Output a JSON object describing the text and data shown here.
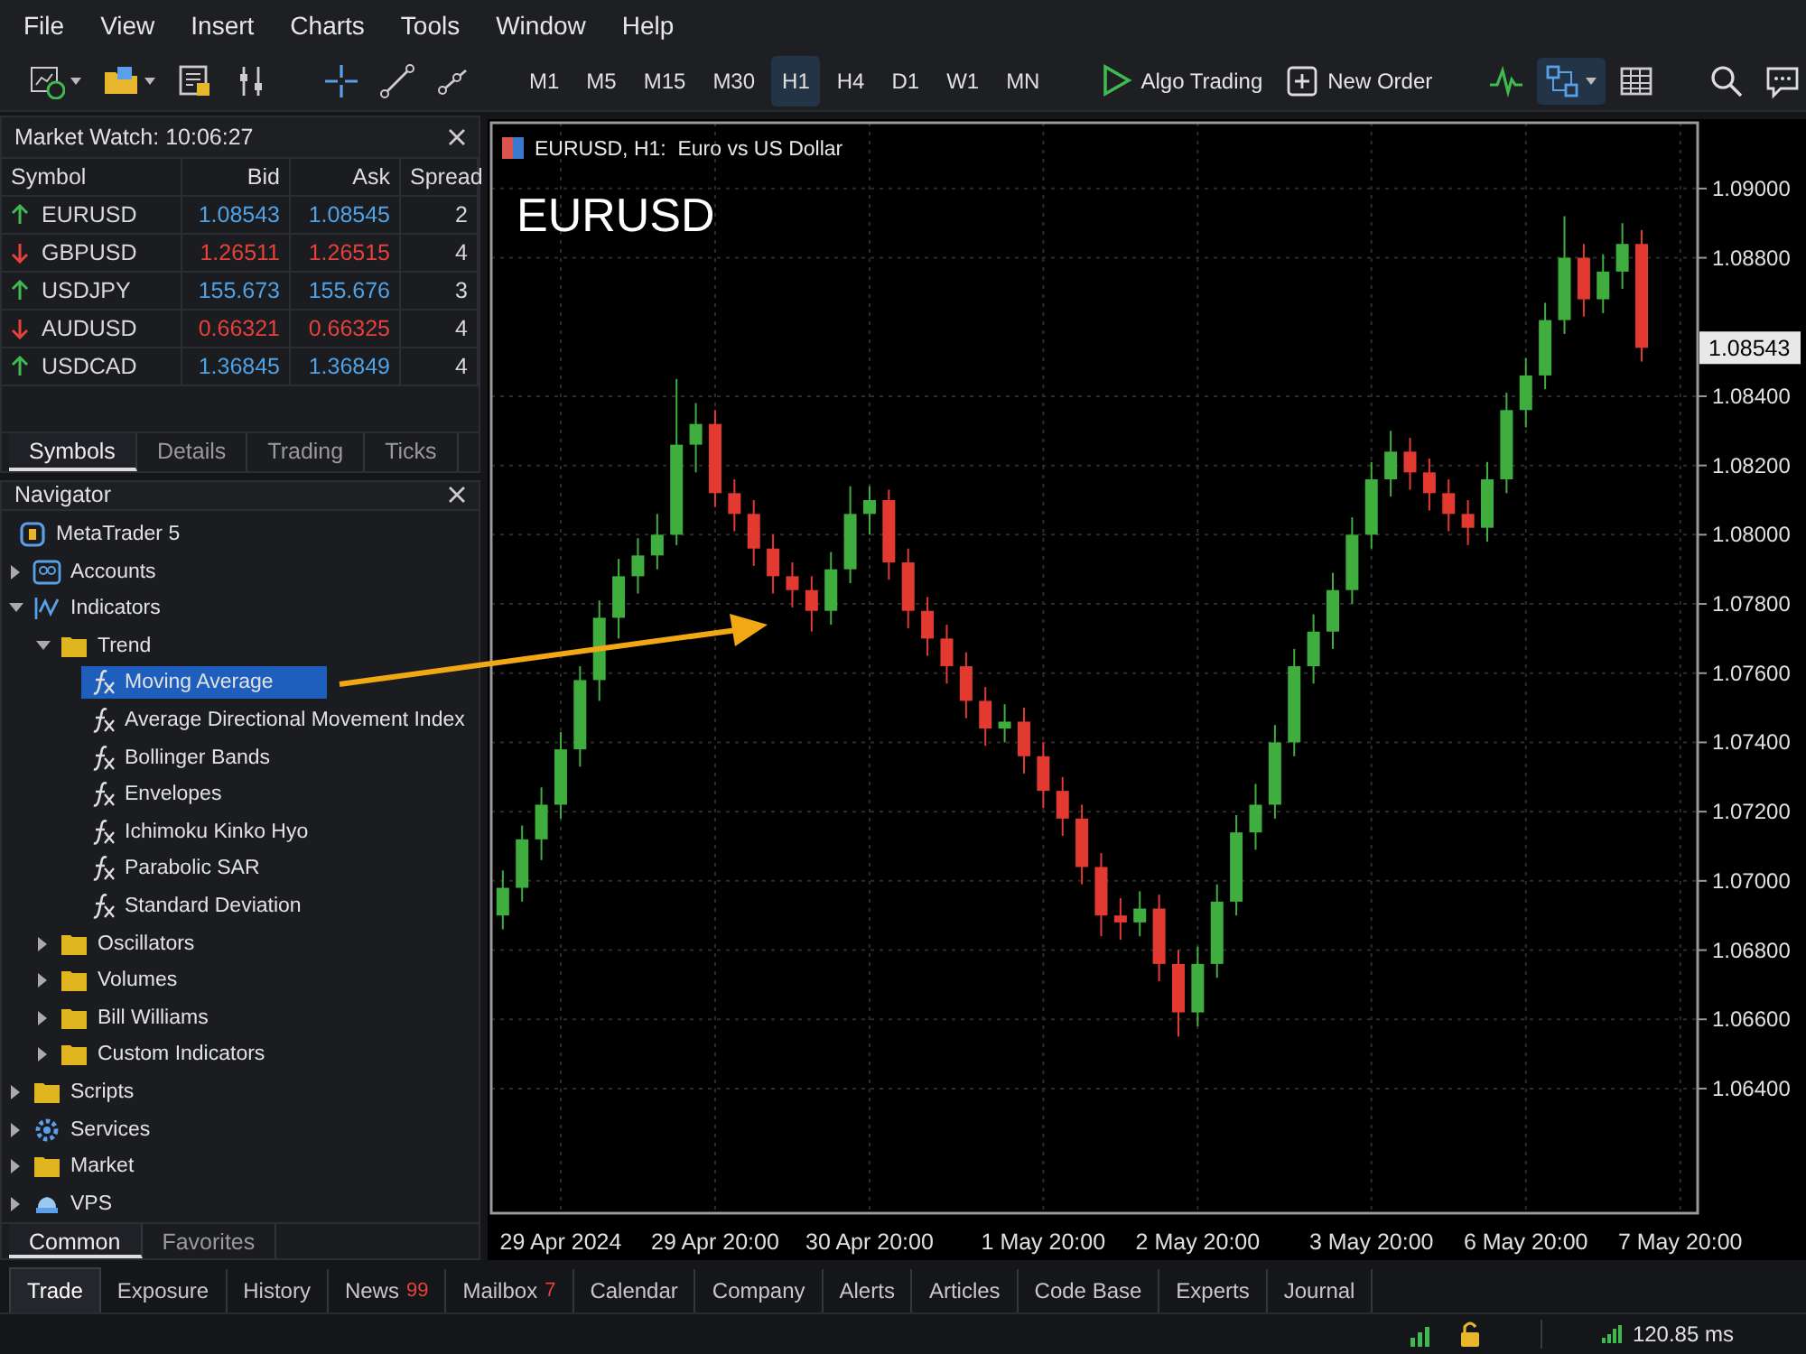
{
  "menu": [
    {
      "label": "File"
    },
    {
      "label": "View"
    },
    {
      "label": "Insert"
    },
    {
      "label": "Charts"
    },
    {
      "label": "Tools"
    },
    {
      "label": "Window"
    },
    {
      "label": "Help"
    }
  ],
  "toolbar": {
    "timeframes": [
      {
        "label": "M1",
        "selected": false
      },
      {
        "label": "M5",
        "selected": false
      },
      {
        "label": "M15",
        "selected": false
      },
      {
        "label": "M30",
        "selected": false
      },
      {
        "label": "H1",
        "selected": true
      },
      {
        "label": "H4",
        "selected": false
      },
      {
        "label": "D1",
        "selected": false
      },
      {
        "label": "W1",
        "selected": false
      },
      {
        "label": "MN",
        "selected": false
      }
    ],
    "actions": [
      {
        "label": "Algo Trading",
        "kind": "play"
      },
      {
        "label": "New Order",
        "kind": "add"
      }
    ]
  },
  "market_watch": {
    "title": "Market Watch: 10:06:27",
    "columns": [
      "Symbol",
      "Bid",
      "Ask",
      "Spread"
    ],
    "rows": [
      {
        "symbol": "EURUSD",
        "rising": true,
        "bid": "1.08543",
        "ask": "1.08545",
        "spread": "2"
      },
      {
        "symbol": "GBPUSD",
        "rising": false,
        "bid": "1.26511",
        "ask": "1.26515",
        "spread": "4"
      },
      {
        "symbol": "USDJPY",
        "rising": true,
        "bid": "155.673",
        "ask": "155.676",
        "spread": "3"
      },
      {
        "symbol": "AUDUSD",
        "rising": false,
        "bid": "0.66321",
        "ask": "0.66325",
        "spread": "4"
      },
      {
        "symbol": "USDCAD",
        "rising": true,
        "bid": "1.36845",
        "ask": "1.36849",
        "spread": "4"
      }
    ],
    "tabs": [
      {
        "label": "Symbols",
        "selected": true
      },
      {
        "label": "Details",
        "selected": false
      },
      {
        "label": "Trading",
        "selected": false
      },
      {
        "label": "Ticks",
        "selected": false
      }
    ]
  },
  "navigator": {
    "title": "Navigator",
    "tree": [
      {
        "label": "MetaTrader 5",
        "kind": "terminal",
        "selected": false,
        "children": [
          {
            "label": "Accounts",
            "kind": "accounts",
            "expanded": false,
            "selected": false
          },
          {
            "label": "Indicators",
            "kind": "indicators",
            "expanded": true,
            "selected": false,
            "children": [
              {
                "label": "Trend",
                "kind": "folder",
                "expanded": true,
                "selected": false,
                "children": [
                  {
                    "label": "Moving Average",
                    "kind": "function",
                    "selected": true
                  },
                  {
                    "label": "Average Directional Movement Index",
                    "kind": "function",
                    "selected": false
                  },
                  {
                    "label": "Bollinger Bands",
                    "kind": "function",
                    "selected": false
                  },
                  {
                    "label": "Envelopes",
                    "kind": "function",
                    "selected": false
                  },
                  {
                    "label": "Ichimoku Kinko Hyo",
                    "kind": "function",
                    "selected": false
                  },
                  {
                    "label": "Parabolic SAR",
                    "kind": "function",
                    "selected": false
                  },
                  {
                    "label": "Standard Deviation",
                    "kind": "function",
                    "selected": false
                  }
                ]
              },
              {
                "label": "Oscillators",
                "kind": "folder",
                "expanded": false,
                "selected": false
              },
              {
                "label": "Volumes",
                "kind": "folder",
                "expanded": false,
                "selected": false
              },
              {
                "label": "Bill Williams",
                "kind": "folder",
                "expanded": false,
                "selected": false
              },
              {
                "label": "Custom Indicators",
                "kind": "folder",
                "expanded": false,
                "selected": false
              }
            ]
          },
          {
            "label": "Scripts",
            "kind": "folder",
            "expanded": false,
            "selected": false
          },
          {
            "label": "Services",
            "kind": "services",
            "expanded": false,
            "selected": false
          },
          {
            "label": "Market",
            "kind": "folder",
            "expanded": false,
            "selected": false
          },
          {
            "label": "VPS",
            "kind": "vps",
            "expanded": false,
            "selected": false
          }
        ]
      }
    ],
    "tabs": [
      {
        "label": "Common",
        "selected": true
      },
      {
        "label": "Favorites",
        "selected": false
      }
    ]
  },
  "chart": {
    "title": "EURUSD, H1:  Euro vs US Dollar",
    "symbol": "EURUSD",
    "price_label": "1.08543",
    "chart_data": {
      "type": "candlestick",
      "grid": true,
      "ylim": [
        1.0604,
        1.0919
      ],
      "categories": [
        null,
        null,
        null,
        "29 Apr 2024",
        null,
        null,
        null,
        null,
        null,
        null,
        null,
        "29 Apr 20:00",
        null,
        null,
        null,
        null,
        null,
        null,
        null,
        "30 Apr 20:00",
        null,
        null,
        null,
        null,
        null,
        null,
        null,
        null,
        "1 May 20:00",
        null,
        null,
        null,
        null,
        null,
        null,
        null,
        "2 May 20:00",
        null,
        null,
        null,
        null,
        null,
        null,
        null,
        null,
        "3 May 20:00",
        null,
        null,
        null,
        null,
        null,
        null,
        null,
        "6 May 20:00",
        null,
        null,
        null,
        null,
        null,
        null,
        null,
        "7 May 20:00"
      ],
      "yticks": [
        {
          "value": 1.09,
          "label": "1.09000"
        },
        {
          "value": 1.088,
          "label": "1.08800"
        },
        {
          "value": 1.084,
          "label": "1.08400"
        },
        {
          "value": 1.082,
          "label": "1.08200"
        },
        {
          "value": 1.08,
          "label": "1.08000"
        },
        {
          "value": 1.078,
          "label": "1.07800"
        },
        {
          "value": 1.076,
          "label": "1.07600"
        },
        {
          "value": 1.074,
          "label": "1.07400"
        },
        {
          "value": 1.072,
          "label": "1.07200"
        },
        {
          "value": 1.07,
          "label": "1.07000"
        },
        {
          "value": 1.068,
          "label": "1.06800"
        },
        {
          "value": 1.066,
          "label": "1.06600"
        },
        {
          "value": 1.064,
          "label": "1.06400"
        }
      ],
      "ohlc": [
        [
          1.069,
          1.0703,
          1.0686,
          1.0698
        ],
        [
          1.0698,
          1.0716,
          1.0694,
          1.0712
        ],
        [
          1.0712,
          1.0727,
          1.0706,
          1.0722
        ],
        [
          1.0722,
          1.0743,
          1.0718,
          1.0738
        ],
        [
          1.0738,
          1.0762,
          1.0733,
          1.0758
        ],
        [
          1.0758,
          1.0781,
          1.0752,
          1.0776
        ],
        [
          1.0776,
          1.0793,
          1.077,
          1.0788
        ],
        [
          1.0788,
          1.0799,
          1.0783,
          1.0794
        ],
        [
          1.0794,
          1.0806,
          1.079,
          1.08
        ],
        [
          1.08,
          1.0845,
          1.0797,
          1.0826
        ],
        [
          1.0826,
          1.0838,
          1.0818,
          1.0832
        ],
        [
          1.0832,
          1.0836,
          1.0808,
          1.0812
        ],
        [
          1.0812,
          1.0816,
          1.0801,
          1.0806
        ],
        [
          1.0806,
          1.081,
          1.0791,
          1.0796
        ],
        [
          1.0796,
          1.08,
          1.0783,
          1.0788
        ],
        [
          1.0788,
          1.0792,
          1.0779,
          1.0784
        ],
        [
          1.0784,
          1.0788,
          1.0772,
          1.0778
        ],
        [
          1.0778,
          1.0795,
          1.0774,
          1.079
        ],
        [
          1.079,
          1.0814,
          1.0786,
          1.0806
        ],
        [
          1.0806,
          1.0814,
          1.08,
          1.081
        ],
        [
          1.081,
          1.0813,
          1.0787,
          1.0792
        ],
        [
          1.0792,
          1.0796,
          1.0773,
          1.0778
        ],
        [
          1.0778,
          1.0782,
          1.0765,
          1.077
        ],
        [
          1.077,
          1.0774,
          1.0757,
          1.0762
        ],
        [
          1.0762,
          1.0766,
          1.0747,
          1.0752
        ],
        [
          1.0752,
          1.0756,
          1.0739,
          1.0744
        ],
        [
          1.0744,
          1.0751,
          1.074,
          1.0746
        ],
        [
          1.0746,
          1.075,
          1.0731,
          1.0736
        ],
        [
          1.0736,
          1.074,
          1.0721,
          1.0726
        ],
        [
          1.0726,
          1.073,
          1.0713,
          1.0718
        ],
        [
          1.0718,
          1.0722,
          1.0699,
          1.0704
        ],
        [
          1.0704,
          1.0708,
          1.0684,
          1.069
        ],
        [
          1.069,
          1.0695,
          1.0683,
          1.0688
        ],
        [
          1.0688,
          1.0697,
          1.0684,
          1.0692
        ],
        [
          1.0692,
          1.0696,
          1.0671,
          1.0676
        ],
        [
          1.0676,
          1.068,
          1.0655,
          1.0662
        ],
        [
          1.0662,
          1.0681,
          1.0658,
          1.0676
        ],
        [
          1.0676,
          1.0699,
          1.0672,
          1.0694
        ],
        [
          1.0694,
          1.0719,
          1.069,
          1.0714
        ],
        [
          1.0714,
          1.0728,
          1.0709,
          1.0722
        ],
        [
          1.0722,
          1.0745,
          1.0718,
          1.074
        ],
        [
          1.074,
          1.0767,
          1.0736,
          1.0762
        ],
        [
          1.0762,
          1.0777,
          1.0757,
          1.0772
        ],
        [
          1.0772,
          1.0789,
          1.0767,
          1.0784
        ],
        [
          1.0784,
          1.0805,
          1.078,
          1.08
        ],
        [
          1.08,
          1.0821,
          1.0796,
          1.0816
        ],
        [
          1.0816,
          1.083,
          1.0811,
          1.0824
        ],
        [
          1.0824,
          1.0828,
          1.0813,
          1.0818
        ],
        [
          1.0818,
          1.0822,
          1.0807,
          1.0812
        ],
        [
          1.0812,
          1.0816,
          1.0801,
          1.0806
        ],
        [
          1.0806,
          1.081,
          1.0797,
          1.0802
        ],
        [
          1.0802,
          1.0821,
          1.0798,
          1.0816
        ],
        [
          1.0816,
          1.0841,
          1.0812,
          1.0836
        ],
        [
          1.0836,
          1.0851,
          1.0831,
          1.0846
        ],
        [
          1.0846,
          1.0867,
          1.0842,
          1.0862
        ],
        [
          1.0862,
          1.0892,
          1.0858,
          1.088
        ],
        [
          1.088,
          1.0884,
          1.0863,
          1.0868
        ],
        [
          1.0868,
          1.0881,
          1.0864,
          1.0876
        ],
        [
          1.0876,
          1.089,
          1.0871,
          1.0884
        ],
        [
          1.0884,
          1.0888,
          1.085,
          1.0854
        ],
        null,
        null
      ]
    }
  },
  "terminal_tabs": [
    {
      "label": "Trade",
      "selected": true
    },
    {
      "label": "Exposure",
      "selected": false
    },
    {
      "label": "History",
      "selected": false
    },
    {
      "label": "News",
      "badge": "99",
      "selected": false
    },
    {
      "label": "Mailbox",
      "badge": "7",
      "selected": false
    },
    {
      "label": "Calendar",
      "selected": false
    },
    {
      "label": "Company",
      "selected": false
    },
    {
      "label": "Alerts",
      "selected": false
    },
    {
      "label": "Articles",
      "selected": false
    },
    {
      "label": "Code Base",
      "selected": false
    },
    {
      "label": "Experts",
      "selected": false
    },
    {
      "label": "Journal",
      "selected": false
    }
  ],
  "status_bar": {
    "ping": "120.85 ms"
  }
}
